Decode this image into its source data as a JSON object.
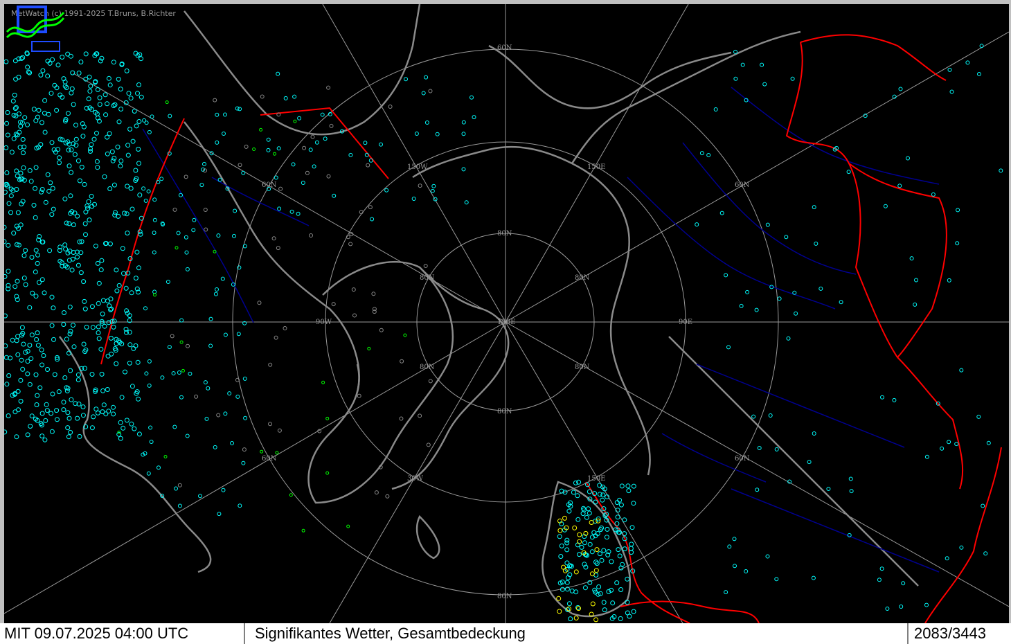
{
  "app": {
    "copyright": "MetWatch  (c) 1991-2025 T.Bruns, B.Richter",
    "logo_icon": "metwatch-logo-icon"
  },
  "status": {
    "time": "MIT 09.07.2025 04:00 UTC",
    "product": "Signifikantes Wetter, Gesamtbedeckung",
    "count": "2083/3443"
  },
  "map": {
    "projection_center_label": "150E",
    "grid_labels": [
      "60N",
      "60N",
      "60N",
      "60N",
      "80N",
      "80N",
      "80N",
      "80N",
      "80N",
      "80N",
      "80N",
      "150W",
      "150E",
      "90W",
      "90E",
      "30W",
      "150E",
      "60N"
    ],
    "colors": {
      "background": "#000000",
      "coastline": "#8a8a8a",
      "rivers": "#000080",
      "borders": "#ff0000",
      "grid": "#9a9a9a",
      "station_clear": "#00ffff",
      "station_fog": "#ffff00",
      "station_rain": "#00ff00"
    }
  }
}
